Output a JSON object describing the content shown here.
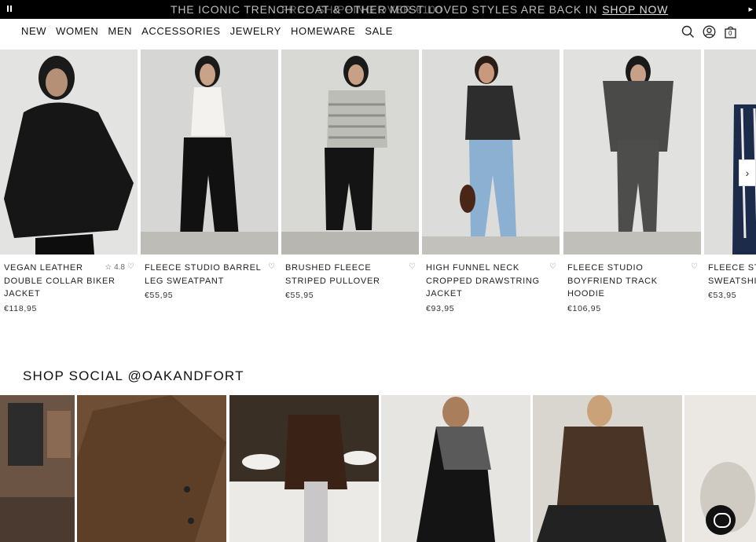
{
  "announcement": {
    "primary": "THE ICONIC TRENCH COAT & OTHER MOST LOVED STYLES ARE BACK IN",
    "overlap": "FREE SHIPPING OVER €100",
    "link": "SHOP NOW"
  },
  "nav": {
    "items": [
      "NEW",
      "WOMEN",
      "MEN",
      "ACCESSORIES",
      "JEWELRY",
      "HOMEWARE",
      "SALE"
    ],
    "cart_count": "0"
  },
  "products": [
    {
      "name": "VEGAN LEATHER DOUBLE COLLAR BIKER JACKET",
      "price": "€118,95",
      "rating": "4.8"
    },
    {
      "name": "FLEECE STUDIO BARREL LEG SWEATPANT",
      "price": "€55,95"
    },
    {
      "name": "BRUSHED FLEECE STRIPED PULLOVER",
      "price": "€55,95"
    },
    {
      "name": "HIGH FUNNEL NECK CROPPED DRAWSTRING JACKET",
      "price": "€93,95"
    },
    {
      "name": "FLEECE STUDIO BOYFRIEND TRACK HOODIE",
      "price": "€106,95"
    },
    {
      "name": "FLEECE STUDIO SWEATSHIRT",
      "price": "€53,95"
    }
  ],
  "social": {
    "title": "SHOP SOCIAL @OAKANDFORT"
  },
  "colors": {
    "announce_bg": "#000000",
    "accent": "#111111"
  }
}
